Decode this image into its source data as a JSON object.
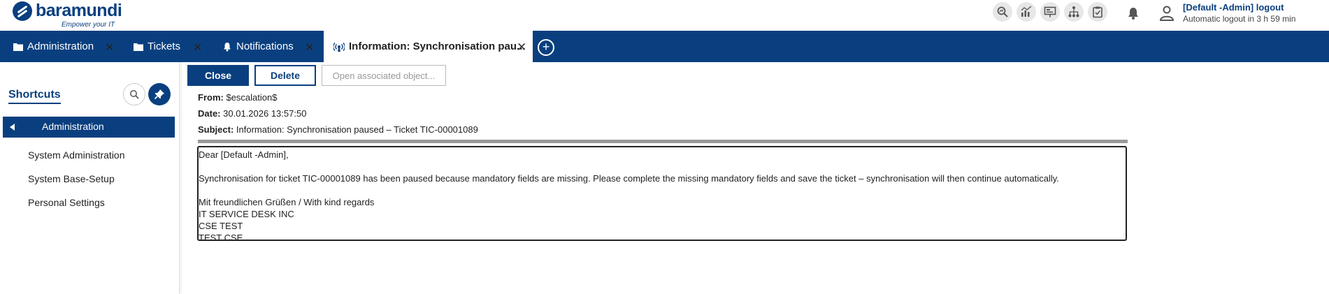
{
  "brand": {
    "name": "baramundi",
    "tagline": "Empower your IT"
  },
  "header": {
    "tool_icons": [
      "search-analytics-icon",
      "chart-icon",
      "presentation-icon",
      "hierarchy-icon",
      "clipboard-check-icon"
    ],
    "user_name": "[Default -Admin]  logout",
    "auto_logout": "Automatic logout in 3 h 59 min"
  },
  "tabs": [
    {
      "label": "Administration",
      "icon": "folder-icon"
    },
    {
      "label": "Tickets",
      "icon": "folder-icon"
    },
    {
      "label": "Notifications",
      "icon": "bell-icon"
    },
    {
      "label": "Information: Synchronisation pau...",
      "icon": "broadcast-icon",
      "active": true
    }
  ],
  "tab_close_glyph": "✕",
  "add_tab_glyph": "+",
  "sidebar": {
    "title": "Shortcuts",
    "section": "Administration",
    "items": [
      "System Administration",
      "System Base-Setup",
      "Personal Settings"
    ]
  },
  "toolbar": {
    "close": "Close",
    "delete": "Delete",
    "open_associated": "Open associated object..."
  },
  "message": {
    "from_label": "From:",
    "from": "$escalation$",
    "date_label": "Date:",
    "date": "30.01.2026 13:57:50",
    "subject_label": "Subject:",
    "subject": "Information: Synchronisation paused – Ticket TIC-00001089",
    "body": [
      " Dear [Default -Admin],",
      "Synchronisation for ticket TIC-00001089 has been paused because mandatory fields are missing. Please complete the missing mandatory fields and save the ticket – synchronisation will then continue automatically.",
      "Mit freundlichen Grüßen / With kind regards",
      "IT SERVICE DESK INC",
      "CSE TEST",
      "TEST CSE"
    ]
  },
  "colors": {
    "primary": "#0a3f7f",
    "divider": "#999999"
  }
}
